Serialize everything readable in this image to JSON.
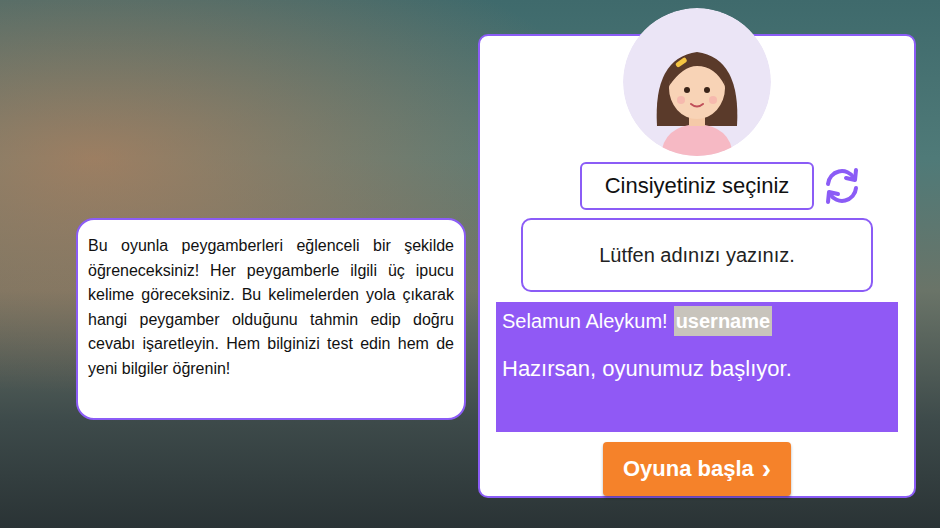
{
  "intro": {
    "text": "Bu oyunla peygamberleri eğlenceli bir şekilde öğreneceksiniz! Her peygamberle ilgili üç ipucu kelime göreceksiniz. Bu kelimelerden yola çıkarak hangi peygamber olduğunu tahmin edip doğru cevabı işaretleyin. Hem bilginizi test edin hem de yeni bilgiler öğrenin!"
  },
  "form": {
    "gender_button": "Cinsiyetiniz seçiniz",
    "name_placeholder": "Lütfen adınızı yazınız."
  },
  "greeting": {
    "salutation": "Selamun Aleykum!",
    "username": "username",
    "message": "Hazırsan, oyunumuz başlıyor."
  },
  "start_button": {
    "label": "Oyuna başla",
    "arrow": "›"
  }
}
